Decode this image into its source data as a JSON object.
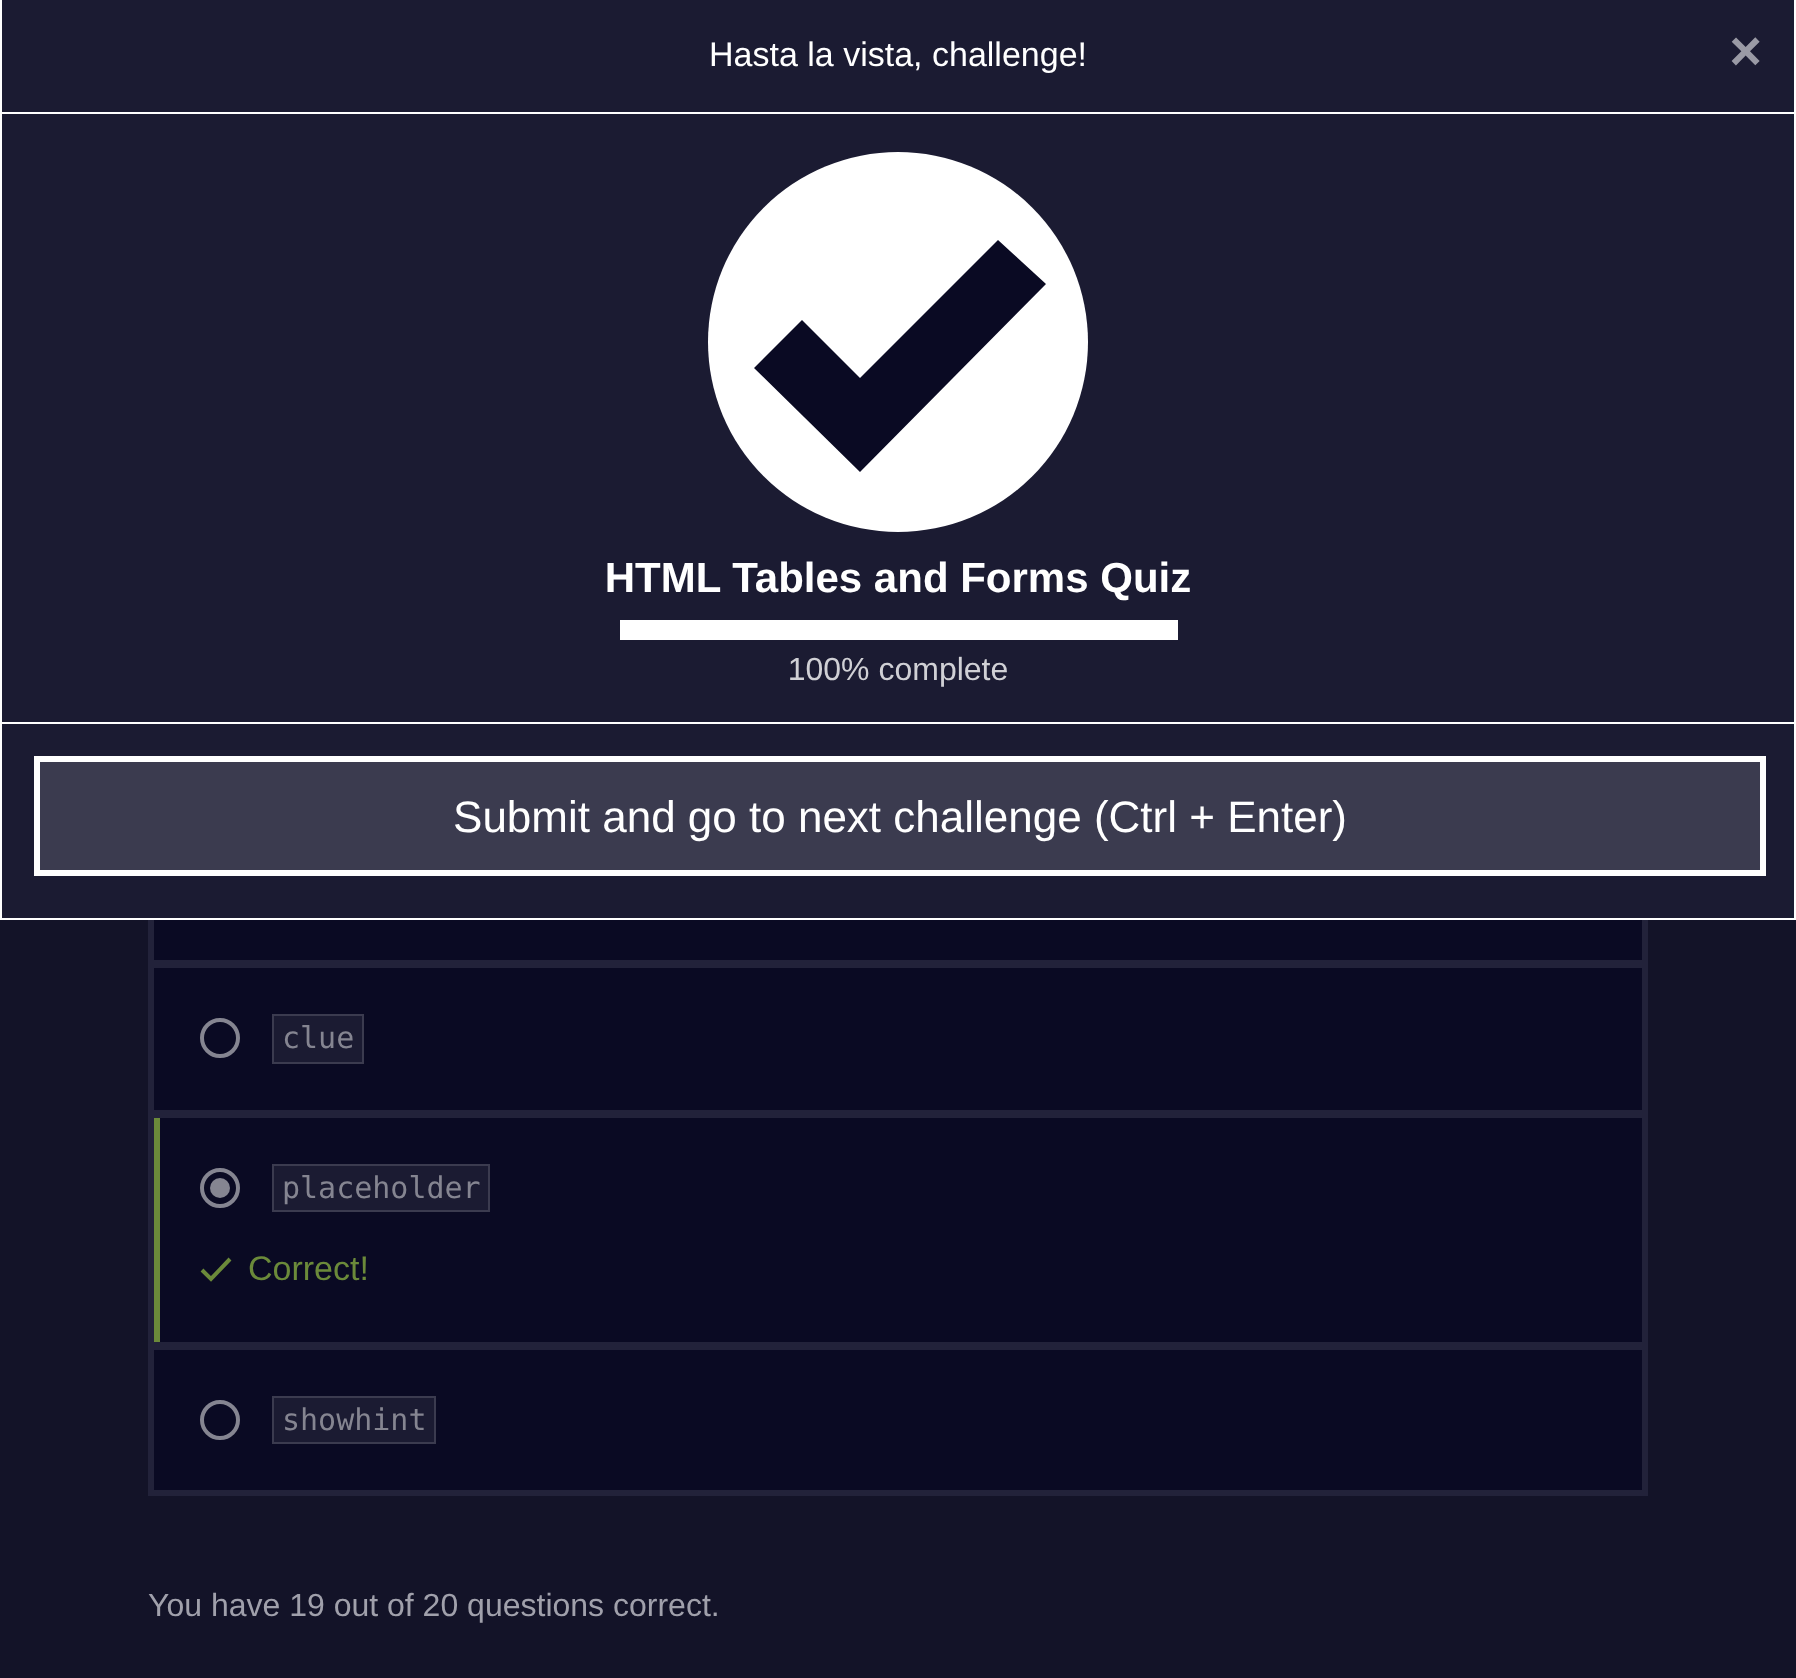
{
  "modal": {
    "title": "Hasta la vista, challenge!",
    "close": "×",
    "quiz_title": "HTML Tables and Forms Quiz",
    "progress": {
      "level": 1
    },
    "progress_text": "100% complete",
    "submit": "Submit and go to next challenge (Ctrl + Enter)"
  },
  "options": [
    {
      "code": "clue",
      "selected": false
    },
    {
      "code": "placeholder",
      "selected": true,
      "feedback": "Correct!"
    },
    {
      "code": "showhint",
      "selected": false
    }
  ],
  "score": "You have 19 out of 20 questions correct."
}
